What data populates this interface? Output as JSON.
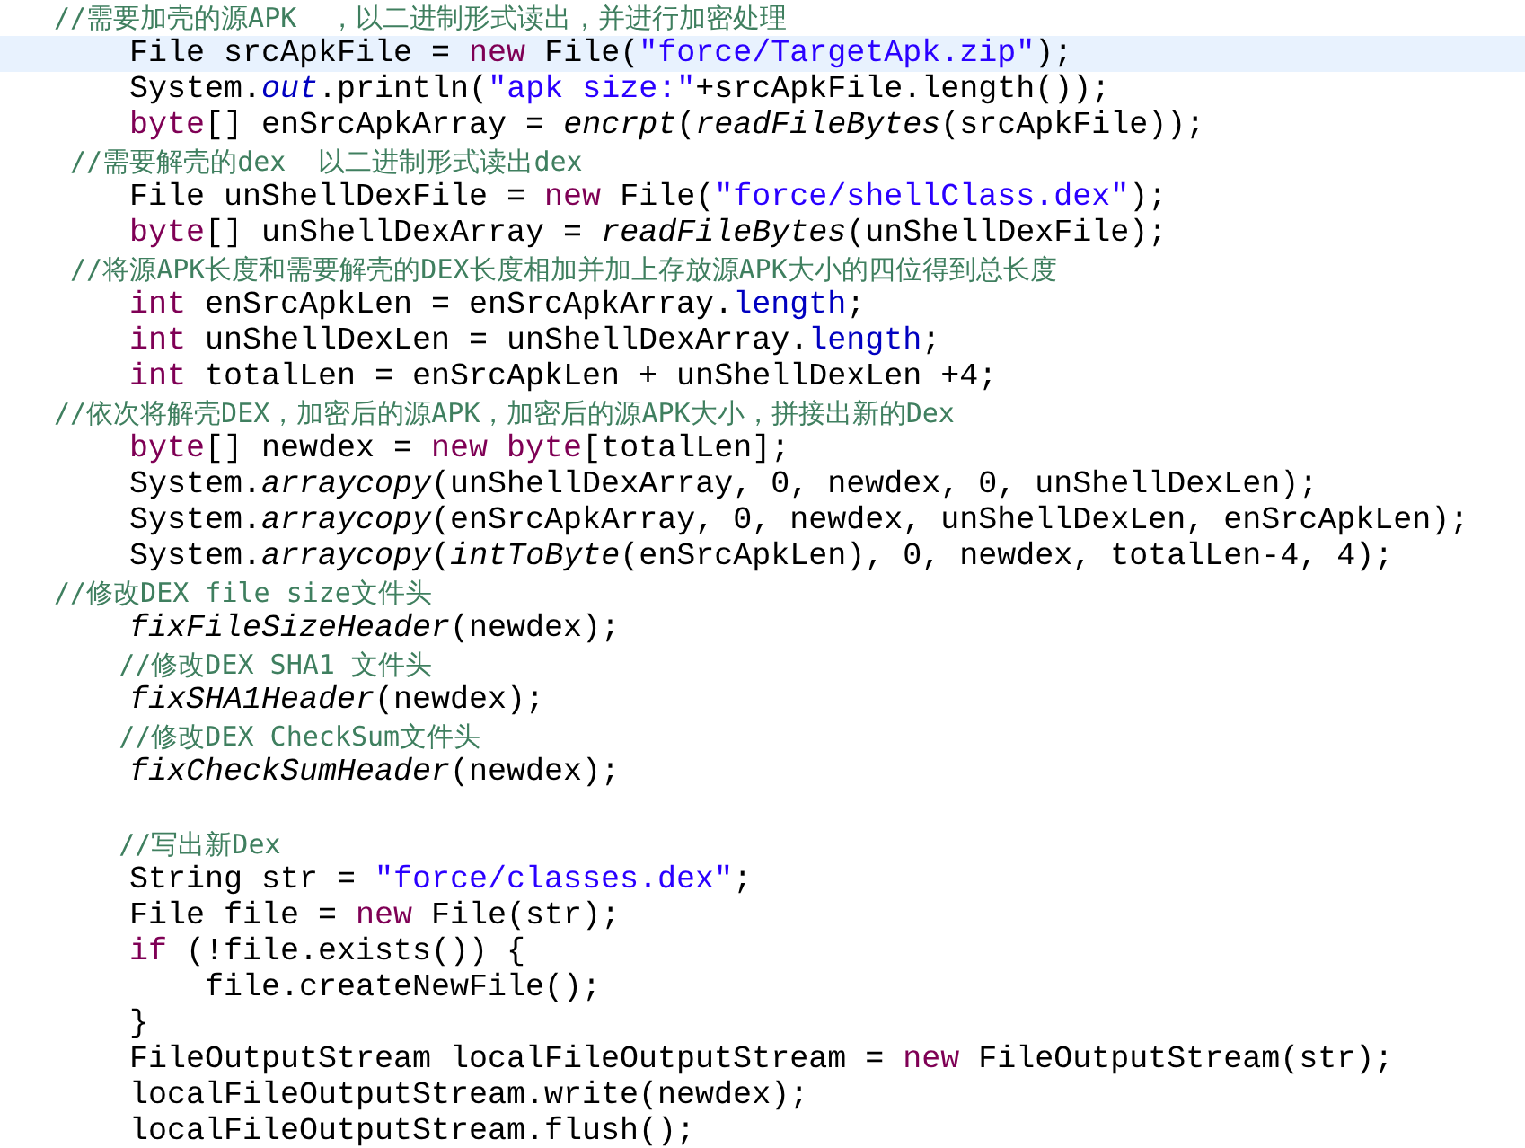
{
  "code_lines": [
    {
      "kind": "code",
      "highlighted": false,
      "tokens": [
        {
          "kind": "comment",
          "text": "//需要加壳的源APK  ，以二进制形式读出，并进行加密处理"
        }
      ]
    },
    {
      "kind": "code",
      "highlighted": true,
      "tokens": [
        {
          "kind": "plain",
          "text": "    File srcApkFile = "
        },
        {
          "kind": "keyword",
          "text": "new"
        },
        {
          "kind": "plain",
          "text": " File("
        },
        {
          "kind": "string",
          "text": "\"force/TargetApk.zip\""
        },
        {
          "kind": "plain",
          "text": ");"
        }
      ]
    },
    {
      "kind": "code",
      "highlighted": false,
      "tokens": [
        {
          "kind": "plain",
          "text": "    System."
        },
        {
          "kind": "field",
          "text": "out"
        },
        {
          "kind": "plain",
          "text": ".println("
        },
        {
          "kind": "string",
          "text": "\"apk size:\""
        },
        {
          "kind": "plain",
          "text": "+srcApkFile.length());"
        }
      ]
    },
    {
      "kind": "code",
      "highlighted": false,
      "tokens": [
        {
          "kind": "keyword",
          "text": "    byte"
        },
        {
          "kind": "plain",
          "text": "[] enSrcApkArray = "
        },
        {
          "kind": "method",
          "text": "encrpt"
        },
        {
          "kind": "plain",
          "text": "("
        },
        {
          "kind": "method",
          "text": "readFileBytes"
        },
        {
          "kind": "plain",
          "text": "(srcApkFile));"
        }
      ]
    },
    {
      "kind": "code",
      "highlighted": false,
      "tokens": [
        {
          "kind": "comment",
          "text": " //需要解壳的dex  以二进制形式读出dex"
        }
      ]
    },
    {
      "kind": "code",
      "highlighted": false,
      "tokens": [
        {
          "kind": "plain",
          "text": "    File unShellDexFile = "
        },
        {
          "kind": "keyword",
          "text": "new"
        },
        {
          "kind": "plain",
          "text": " File("
        },
        {
          "kind": "string",
          "text": "\"force/shellClass.dex\""
        },
        {
          "kind": "plain",
          "text": ");"
        }
      ]
    },
    {
      "kind": "code",
      "highlighted": false,
      "tokens": [
        {
          "kind": "keyword",
          "text": "    byte"
        },
        {
          "kind": "plain",
          "text": "[] unShellDexArray = "
        },
        {
          "kind": "method",
          "text": "readFileBytes"
        },
        {
          "kind": "plain",
          "text": "(unShellDexFile);"
        }
      ]
    },
    {
      "kind": "code",
      "highlighted": false,
      "tokens": [
        {
          "kind": "comment",
          "text": " //将源APK长度和需要解壳的DEX长度相加并加上存放源APK大小的四位得到总长度"
        }
      ]
    },
    {
      "kind": "code",
      "highlighted": false,
      "tokens": [
        {
          "kind": "keyword",
          "text": "    int"
        },
        {
          "kind": "plain",
          "text": " enSrcApkLen = enSrcApkArray."
        },
        {
          "kind": "member",
          "text": "length"
        },
        {
          "kind": "plain",
          "text": ";"
        }
      ]
    },
    {
      "kind": "code",
      "highlighted": false,
      "tokens": [
        {
          "kind": "keyword",
          "text": "    int"
        },
        {
          "kind": "plain",
          "text": " unShellDexLen = unShellDexArray."
        },
        {
          "kind": "member",
          "text": "length"
        },
        {
          "kind": "plain",
          "text": ";"
        }
      ]
    },
    {
      "kind": "code",
      "highlighted": false,
      "tokens": [
        {
          "kind": "keyword",
          "text": "    int"
        },
        {
          "kind": "plain",
          "text": " totalLen = enSrcApkLen + unShellDexLen +4;"
        }
      ]
    },
    {
      "kind": "code",
      "highlighted": false,
      "tokens": [
        {
          "kind": "comment",
          "text": "//依次将解壳DEX，加密后的源APK，加密后的源APK大小，拼接出新的Dex"
        }
      ]
    },
    {
      "kind": "code",
      "highlighted": false,
      "tokens": [
        {
          "kind": "keyword",
          "text": "    byte"
        },
        {
          "kind": "plain",
          "text": "[] newdex = "
        },
        {
          "kind": "keyword",
          "text": "new byte"
        },
        {
          "kind": "plain",
          "text": "[totalLen];"
        }
      ]
    },
    {
      "kind": "code",
      "highlighted": false,
      "tokens": [
        {
          "kind": "plain",
          "text": "    System."
        },
        {
          "kind": "method",
          "text": "arraycopy"
        },
        {
          "kind": "plain",
          "text": "(unShellDexArray, 0, newdex, 0, unShellDexLen);"
        }
      ]
    },
    {
      "kind": "code",
      "highlighted": false,
      "tokens": [
        {
          "kind": "plain",
          "text": "    System."
        },
        {
          "kind": "method",
          "text": "arraycopy"
        },
        {
          "kind": "plain",
          "text": "(enSrcApkArray, 0, newdex, unShellDexLen, enSrcApkLen);"
        }
      ]
    },
    {
      "kind": "code",
      "highlighted": false,
      "tokens": [
        {
          "kind": "plain",
          "text": "    System."
        },
        {
          "kind": "method",
          "text": "arraycopy"
        },
        {
          "kind": "plain",
          "text": "("
        },
        {
          "kind": "method",
          "text": "intToByte"
        },
        {
          "kind": "plain",
          "text": "(enSrcApkLen), 0, newdex, totalLen-4, 4);"
        }
      ]
    },
    {
      "kind": "code",
      "highlighted": false,
      "tokens": [
        {
          "kind": "comment",
          "text": "//修改DEX file size文件头"
        }
      ]
    },
    {
      "kind": "code",
      "highlighted": false,
      "tokens": [
        {
          "kind": "method",
          "text": "    fixFileSizeHeader"
        },
        {
          "kind": "plain",
          "text": "(newdex);"
        }
      ]
    },
    {
      "kind": "code",
      "highlighted": false,
      "tokens": [
        {
          "kind": "comment",
          "text": "    //修改DEX SHA1 文件头"
        }
      ]
    },
    {
      "kind": "code",
      "highlighted": false,
      "tokens": [
        {
          "kind": "method",
          "text": "    fixSHA1Header"
        },
        {
          "kind": "plain",
          "text": "(newdex);"
        }
      ]
    },
    {
      "kind": "code",
      "highlighted": false,
      "tokens": [
        {
          "kind": "comment",
          "text": "    //修改DEX CheckSum文件头"
        }
      ]
    },
    {
      "kind": "code",
      "highlighted": false,
      "tokens": [
        {
          "kind": "method",
          "text": "    fixCheckSumHeader"
        },
        {
          "kind": "plain",
          "text": "(newdex);"
        }
      ]
    },
    {
      "kind": "blank",
      "highlighted": false
    },
    {
      "kind": "code",
      "highlighted": false,
      "tokens": [
        {
          "kind": "comment",
          "text": "    //写出新Dex"
        }
      ]
    },
    {
      "kind": "code",
      "highlighted": false,
      "tokens": [
        {
          "kind": "plain",
          "text": "    String str = "
        },
        {
          "kind": "string",
          "text": "\"force/classes.dex\""
        },
        {
          "kind": "plain",
          "text": ";"
        }
      ]
    },
    {
      "kind": "code",
      "highlighted": false,
      "tokens": [
        {
          "kind": "plain",
          "text": "    File file = "
        },
        {
          "kind": "keyword",
          "text": "new"
        },
        {
          "kind": "plain",
          "text": " File(str);"
        }
      ]
    },
    {
      "kind": "code",
      "highlighted": false,
      "tokens": [
        {
          "kind": "keyword",
          "text": "    if"
        },
        {
          "kind": "plain",
          "text": " (!file.exists()) {"
        }
      ]
    },
    {
      "kind": "code",
      "highlighted": false,
      "tokens": [
        {
          "kind": "plain",
          "text": "        file.createNewFile();"
        }
      ]
    },
    {
      "kind": "code",
      "highlighted": false,
      "tokens": [
        {
          "kind": "plain",
          "text": "    }"
        }
      ]
    },
    {
      "kind": "code",
      "highlighted": false,
      "tokens": [
        {
          "kind": "plain",
          "text": "    FileOutputStream localFileOutputStream = "
        },
        {
          "kind": "keyword",
          "text": "new"
        },
        {
          "kind": "plain",
          "text": " FileOutputStream(str);"
        }
      ]
    },
    {
      "kind": "code",
      "highlighted": false,
      "tokens": [
        {
          "kind": "plain",
          "text": "    localFileOutputStream.write(newdex);"
        }
      ]
    },
    {
      "kind": "code",
      "highlighted": false,
      "tokens": [
        {
          "kind": "plain",
          "text": "    localFileOutputStream.flush();"
        }
      ]
    }
  ]
}
